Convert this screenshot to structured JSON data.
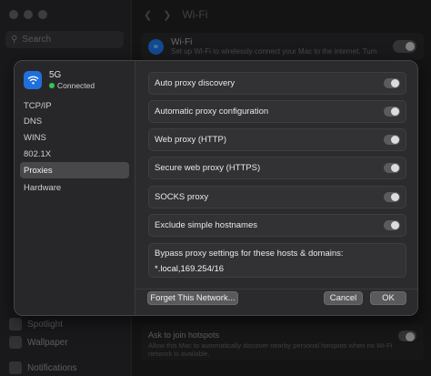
{
  "background": {
    "search_placeholder": "Search",
    "title": "Wi-Fi",
    "wifi_card": {
      "title": "Wi-Fi",
      "subtitle": "Set up Wi-Fi to wirelessly connect your Mac to the internet. Turn"
    },
    "sidebar_items": [
      "Spotlight",
      "Wallpaper",
      "Notifications"
    ],
    "hotspot": {
      "title": "Ask to join hotspots",
      "desc": "Allow this Mac to automatically discover nearby personal hotspots when no Wi-Fi network is available."
    }
  },
  "sheet": {
    "network": {
      "name": "5G",
      "status": "Connected"
    },
    "sidebar": [
      {
        "label": "TCP/IP",
        "selected": false
      },
      {
        "label": "DNS",
        "selected": false
      },
      {
        "label": "WINS",
        "selected": false
      },
      {
        "label": "802.1X",
        "selected": false
      },
      {
        "label": "Proxies",
        "selected": true
      },
      {
        "label": "Hardware",
        "selected": false
      }
    ],
    "proxies": [
      {
        "label": "Auto proxy discovery",
        "enabled": false
      },
      {
        "label": "Automatic proxy configuration",
        "enabled": false
      },
      {
        "label": "Web proxy (HTTP)",
        "enabled": false
      },
      {
        "label": "Secure web proxy (HTTPS)",
        "enabled": false
      },
      {
        "label": "SOCKS proxy",
        "enabled": false
      },
      {
        "label": "Exclude simple hostnames",
        "enabled": false
      }
    ],
    "bypass": {
      "label": "Bypass proxy settings for these hosts & domains:",
      "value": "*.local,169.254/16"
    },
    "buttons": {
      "forget": "Forget This Network...",
      "cancel": "Cancel",
      "ok": "OK"
    }
  },
  "colors": {
    "accent": "#1f6fdc",
    "connected": "#32c74f"
  }
}
